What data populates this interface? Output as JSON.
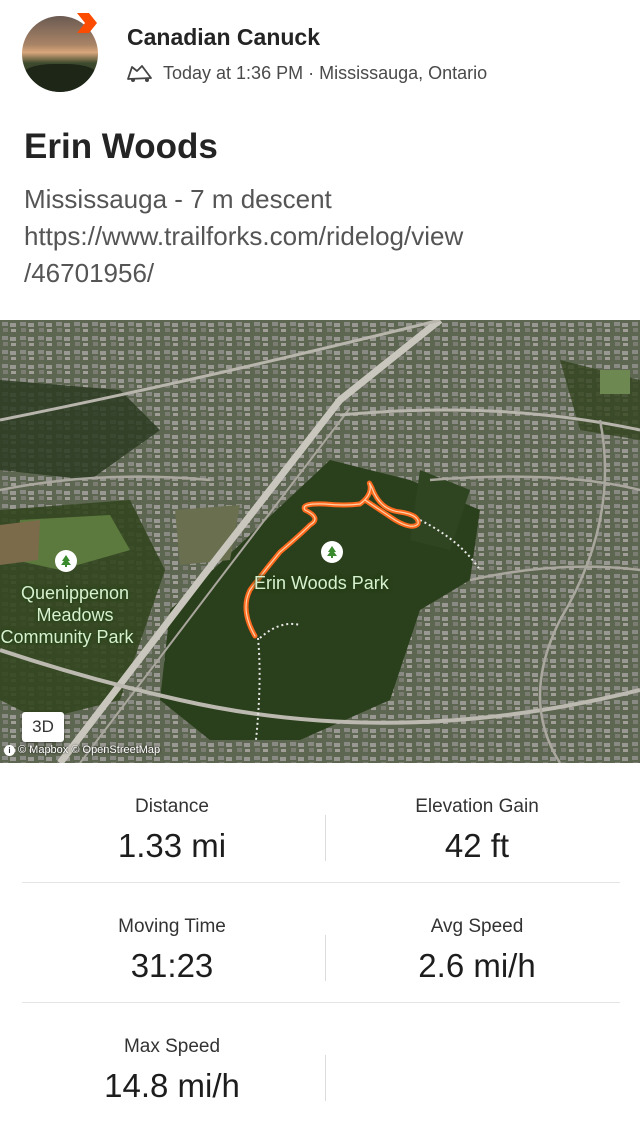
{
  "post": {
    "user_name": "Canadian Canuck",
    "meta_text": "Today at 1:36 PM · Mississauga, Ontario",
    "activity_icon": "bike-ride-icon",
    "badge_color": "#fc4c02"
  },
  "activity": {
    "title": "Erin Woods",
    "desc_line1": "Mississauga - 7 m descent",
    "desc_line2": "https://www.trailforks.com/ridelog/view",
    "desc_line3": "/46701956/"
  },
  "map": {
    "park_label_1": [
      "Quenippenon",
      "Meadows",
      "Community Park"
    ],
    "park_label_2": "Erin Woods Park",
    "button_3d": "3D",
    "attribution": "© Mapbox © OpenStreetMap",
    "route_color": "#fc6a1e"
  },
  "stats": {
    "distance_label": "Distance",
    "distance_value": "1.33 mi",
    "elev_label": "Elevation Gain",
    "elev_value": "42 ft",
    "moving_label": "Moving Time",
    "moving_value": "31:23",
    "avg_label": "Avg Speed",
    "avg_value": "2.6 mi/h",
    "max_label": "Max Speed",
    "max_value": "14.8 mi/h"
  }
}
